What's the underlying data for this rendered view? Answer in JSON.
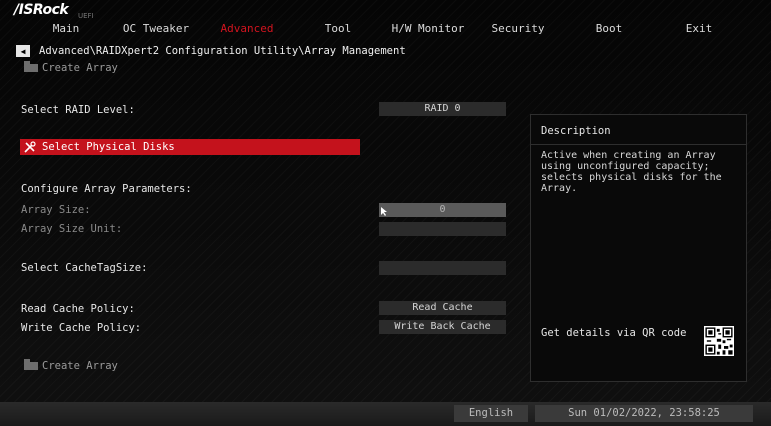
{
  "brand": {
    "logo": "/ISRock",
    "sub": "UEFI"
  },
  "nav": {
    "tabs": [
      {
        "label": "Main"
      },
      {
        "label": "OC Tweaker"
      },
      {
        "label": "Advanced"
      },
      {
        "label": "Tool"
      },
      {
        "label": "H/W Monitor"
      },
      {
        "label": "Security"
      },
      {
        "label": "Boot"
      },
      {
        "label": "Exit"
      }
    ],
    "active": "Advanced"
  },
  "breadcrumb": "Advanced\\RAIDXpert2 Configuration Utility\\Array Management",
  "page": {
    "create_array_top": "Create Array",
    "select_raid_level": {
      "label": "Select RAID Level:",
      "value": "RAID 0"
    },
    "select_physical_disks": "Select Physical Disks",
    "configure_params": "Configure Array Parameters:",
    "array_size": {
      "label": "Array Size:",
      "value": "0"
    },
    "array_size_unit": {
      "label": "Array Size Unit:",
      "value": ""
    },
    "cache_tag_size": {
      "label": "Select CacheTagSize:",
      "value": ""
    },
    "read_cache": {
      "label": "Read Cache Policy:",
      "value": "Read Cache"
    },
    "write_cache": {
      "label": "Write Cache Policy:",
      "value": "Write Back Cache"
    },
    "create_array_bottom": "Create Array"
  },
  "description": {
    "title": "Description",
    "body": "Active when creating an Array using unconfigured capacity; selects physical disks for the Array.",
    "qr_label": "Get details via QR code"
  },
  "footer": {
    "language": "English",
    "datetime": "Sun 01/02/2022, 23:58:25"
  },
  "colors": {
    "accent": "#c4121c",
    "background": "#050505"
  },
  "icons": [
    "back-arrow-icon",
    "folder-icon",
    "wrench-screwdriver-icon",
    "qr-code-icon",
    "mouse-cursor-icon"
  ]
}
